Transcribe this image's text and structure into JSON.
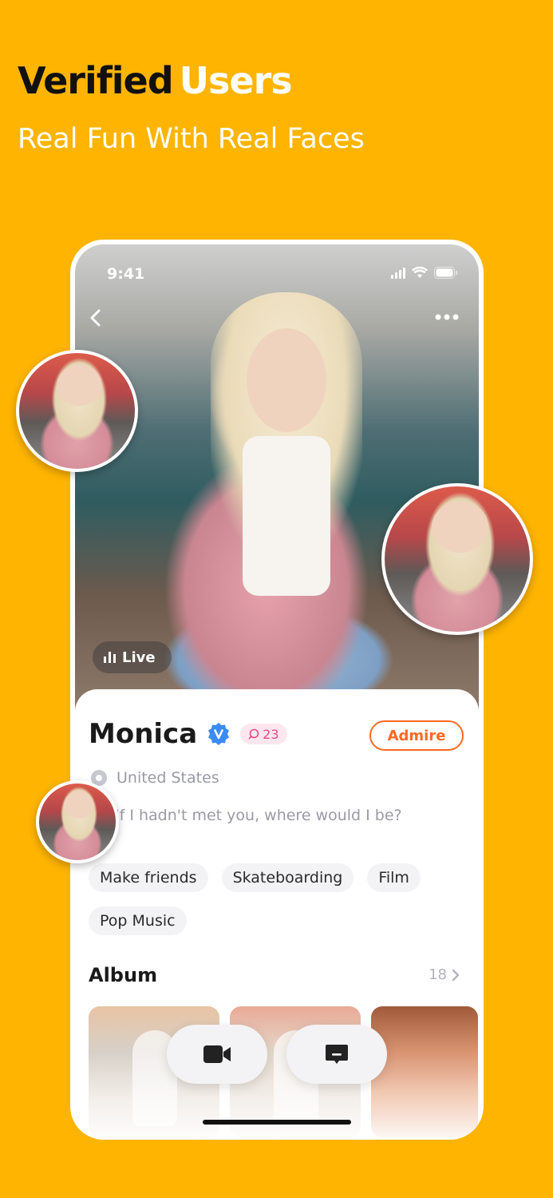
{
  "headline": {
    "dark": "Verified",
    "light": "Users"
  },
  "subhead": "Real Fun With Real Faces",
  "status_bar": {
    "time": "9:41"
  },
  "live_badge": {
    "label": "Live"
  },
  "profile": {
    "name": "Monica",
    "chat_count": "23",
    "admire_label": "Admire",
    "location": "United States",
    "bio": "If I hadn't met you, where would I be?",
    "tags": [
      "Make friends",
      "Skateboarding",
      "Film",
      "Pop Music"
    ]
  },
  "album": {
    "title": "Album",
    "count": "18"
  },
  "colors": {
    "background": "#FEB401",
    "accent": "#FF6A21",
    "verified": "#3B8BF5",
    "chat_pink": "#F0488A"
  },
  "icons": [
    "back-icon",
    "more-icon",
    "signal-icon",
    "wifi-icon",
    "battery-icon",
    "live-bars-icon",
    "verified-icon",
    "chat-icon",
    "location-icon",
    "chevron-right-icon",
    "video-call-icon",
    "message-icon"
  ]
}
